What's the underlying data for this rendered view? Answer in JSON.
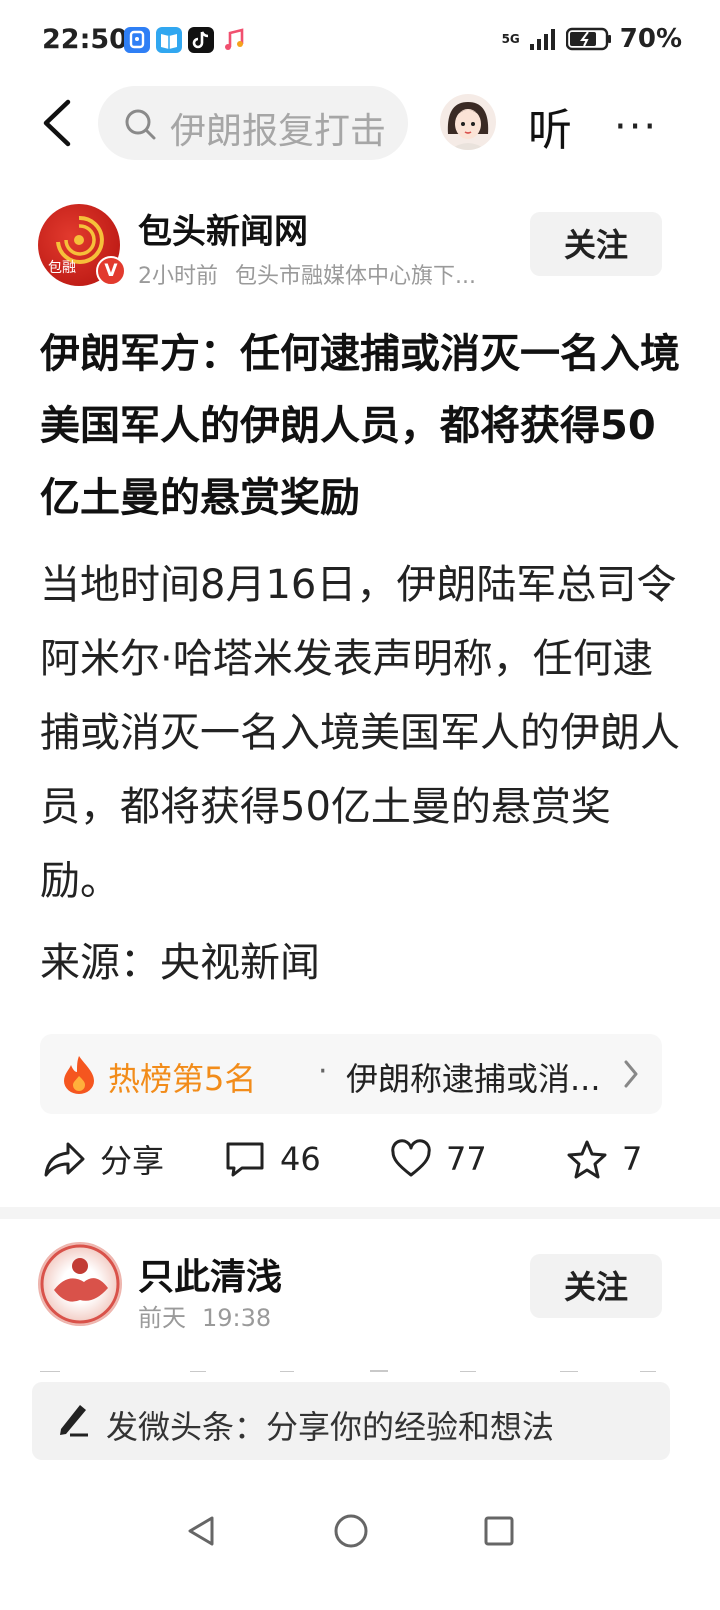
{
  "status_bar": {
    "time": "22:50",
    "network": "5G",
    "battery": "70%",
    "notification_icons": [
      "security-app-icon",
      "reader-app-icon",
      "tiktok-icon",
      "music-icon"
    ]
  },
  "header": {
    "search_placeholder": "伊朗报复打击",
    "listen_label": "听",
    "more_label": "···"
  },
  "author": {
    "name": "包头新闻网",
    "time": "2小时前",
    "description": "包头市融媒体中心旗下...",
    "follow_label": "关注",
    "verified": true
  },
  "article": {
    "headline": "伊朗军方：任何逮捕或消灭一名入境美国军人的伊朗人员，都将获得50亿土曼的悬赏奖励",
    "body": "当地时间8月16日，伊朗陆军总司令阿米尔·哈塔米发表声明称，任何逮捕或消灭一名入境美国军人的伊朗人员，都将获得50亿土曼的悬赏奖励。",
    "source": "来源：央视新闻"
  },
  "hot_list": {
    "rank_label": "热榜第5名",
    "separator": "·",
    "title": "伊朗称逮捕或消..."
  },
  "actions": {
    "share_label": "分享",
    "comment_count": "46",
    "like_count": "77",
    "favorite_count": "7"
  },
  "comment": {
    "user_name": "只此清浅",
    "day": "前天",
    "time": "19:38",
    "follow_label": "关注"
  },
  "compose": {
    "placeholder": "发微头条：分享你的经验和想法"
  },
  "colors": {
    "accent_orange": "#f28c1a",
    "logo_red": "#c8161d",
    "text_primary": "#111111",
    "text_secondary": "#9a9a9a"
  }
}
